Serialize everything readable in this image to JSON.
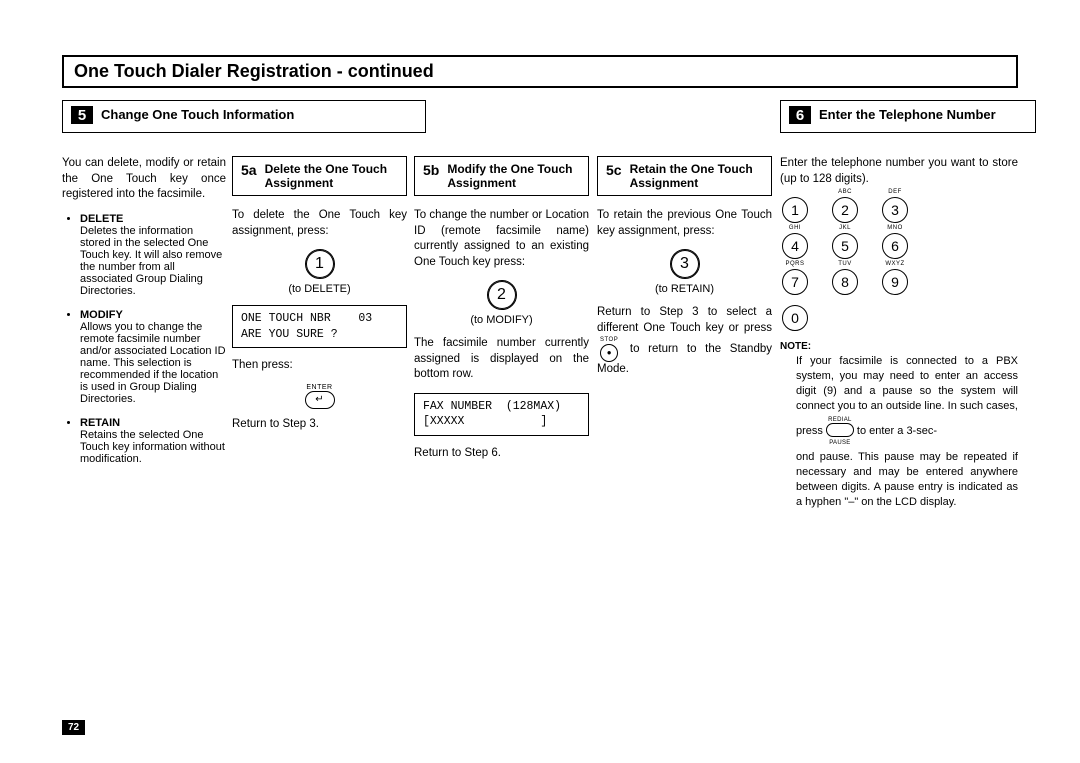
{
  "title": "One Touch Dialer Registration - continued",
  "step5": {
    "num": "5",
    "title": "Change One Touch  Information",
    "intro": "You can delete, modify or retain the One Touch key once registered into the facsimile.",
    "defs": [
      {
        "term": "DELETE",
        "text": "Deletes the information stored in the selected One Touch key. It will also remove the number from all associated Group Dialing Directories."
      },
      {
        "term": "MODIFY",
        "text": "Allows you to change the remote facsimile number and/or associated Location ID name. This selection is recommended if the location is used in Group Dialing Directories."
      },
      {
        "term": "RETAIN",
        "text": "Retains the selected One Touch key information without modification."
      }
    ],
    "a": {
      "num": "5a",
      "title": "Delete the One Touch Assignment",
      "p1": "To delete the One Touch key assignment, press:",
      "key": "1",
      "key_label": "(to DELETE)",
      "lcd": "ONE TOUCH NBR    03\nARE YOU SURE ?",
      "then_press": "Then press:",
      "enter_label": "ENTER",
      "enter_glyph": "↵",
      "return": "Return to Step 3."
    },
    "b": {
      "num": "5b",
      "title": "Modify the One Touch Assignment",
      "p1": "To change the number or Location ID (remote facsimile name) currently assigned to an existing One Touch key press:",
      "key": "2",
      "key_label": "(to MODIFY)",
      "p2": "The facsimile number currently assigned is displayed on the bottom row.",
      "lcd": "FAX NUMBER  (128MAX)\n[XXXXX           ]",
      "return": "Return to Step 6."
    },
    "c": {
      "num": "5c",
      "title": "Retain the One Touch Assignment",
      "p1": "To retain the previous One Touch key assignment, press:",
      "key": "3",
      "key_label": "(to RETAIN)",
      "p2_pre": "Return to Step 3 to select a different One Touch key or press",
      "stop_label": "STOP",
      "p2_post": "to return to the Standby Mode."
    }
  },
  "step6": {
    "num": "6",
    "title": "Enter the Telephone Number",
    "intro": "Enter the telephone number you want to store (up to 128 digits).",
    "keypad": [
      {
        "d": "1",
        "l": ""
      },
      {
        "d": "2",
        "l": "ABC"
      },
      {
        "d": "3",
        "l": "DEF"
      },
      {
        "d": "4",
        "l": "GHI"
      },
      {
        "d": "5",
        "l": "JKL"
      },
      {
        "d": "6",
        "l": "MNO"
      },
      {
        "d": "7",
        "l": "PQRS"
      },
      {
        "d": "8",
        "l": "TUV"
      },
      {
        "d": "9",
        "l": "WXYZ"
      },
      {
        "d": "0",
        "l": ""
      }
    ],
    "note_title": "NOTE:",
    "note_p1": "If your facsimile is connected to a PBX system, you may need to enter an access digit (9) and a pause so the system will connect you to an outside line. In such cases,",
    "note_press": "press",
    "redial_top": "REDIAL",
    "redial_bottom": "PAUSE",
    "note_post": "to enter a 3-sec-",
    "note_p2": "ond pause. This pause may be repeated if necessary and may be entered anywhere between digits. A pause entry is indicated as a hyphen \"–\" on the LCD display."
  },
  "page_number": "72"
}
